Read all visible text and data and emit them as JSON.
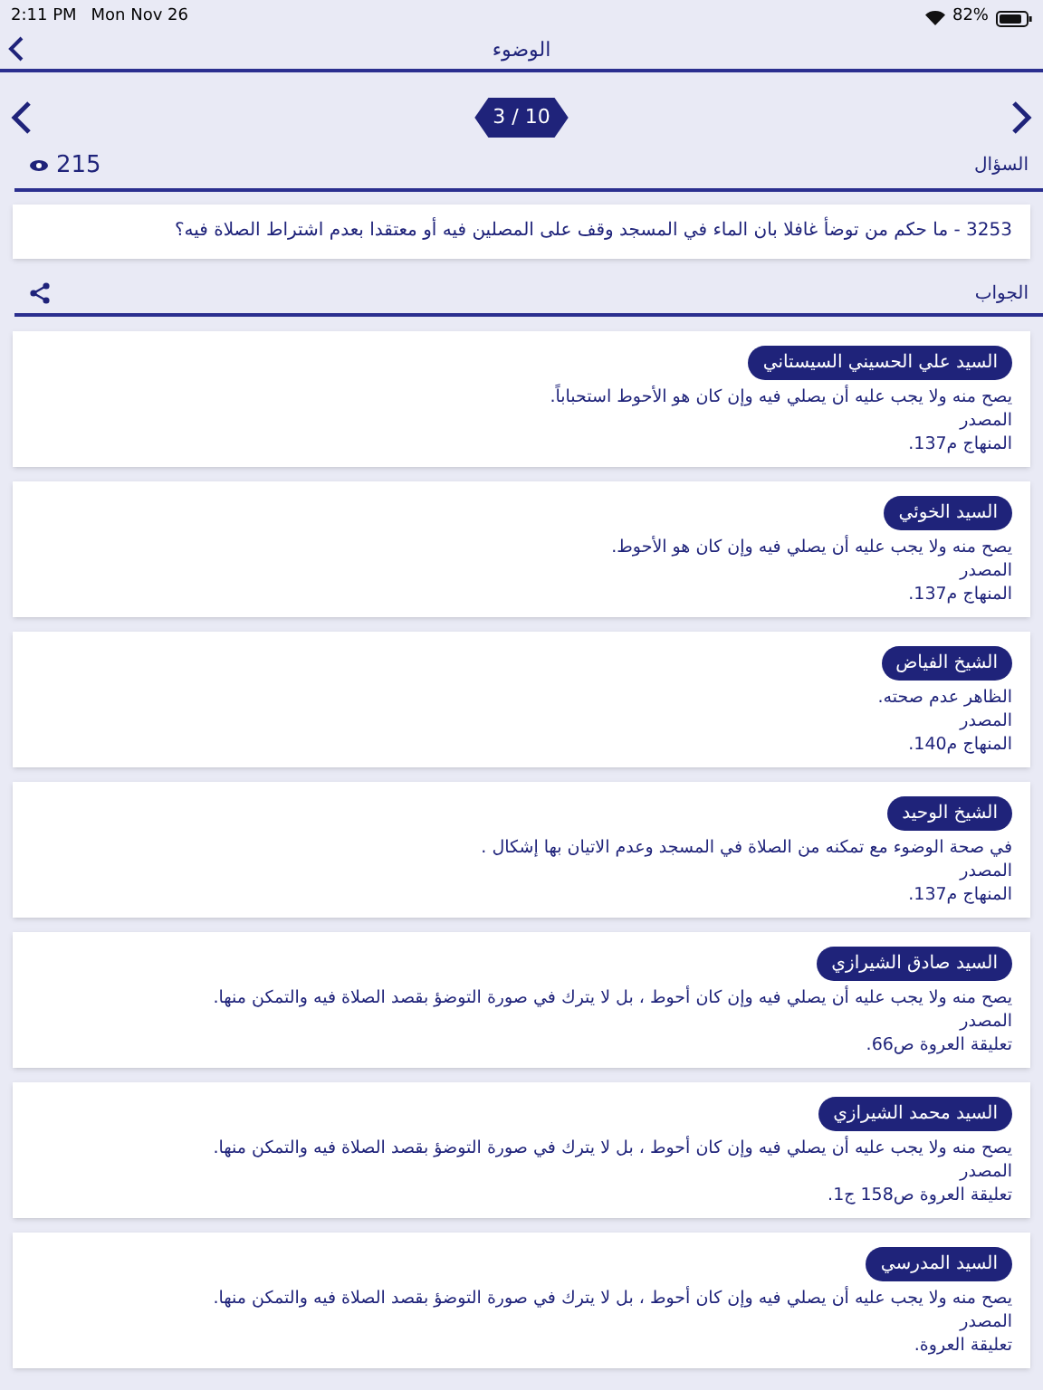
{
  "status_bar": {
    "time": "2:11 PM",
    "date": "Mon Nov 26",
    "battery": "82%"
  },
  "nav": {
    "title": "الوضوء"
  },
  "pager": {
    "label": "3 / 10"
  },
  "question": {
    "heading": "السؤال",
    "views": "215",
    "text": "3253 - ما حكم من توضأ غافلا بان الماء في المسجد وقف على المصلين فيه أو معتقدا بعدم اشتراط الصلاة فيه؟"
  },
  "answer": {
    "heading": "الجواب"
  },
  "answers": [
    {
      "scholar": "السيد علي الحسيني السيستاني",
      "text": "يصح منه ولا يجب عليه أن يصلي فيه وإن كان هو الأحوط استحباباً.",
      "source_label": "المصدر",
      "source": "المنهاج م137."
    },
    {
      "scholar": "السيد الخوئي",
      "text": "يصح منه ولا يجب عليه أن يصلي فيه وإن كان هو الأحوط.",
      "source_label": "المصدر",
      "source": "المنهاج م137."
    },
    {
      "scholar": "الشيخ الفياض",
      "text": "الظاهر عدم صحته.",
      "source_label": "المصدر",
      "source": "المنهاج م140."
    },
    {
      "scholar": "الشيخ الوحيد",
      "text": "في صحة الوضوء مع تمكنه من الصلاة في المسجد وعدم الاتيان بها إشكال .",
      "source_label": "المصدر",
      "source": "المنهاج م137."
    },
    {
      "scholar": "السيد صادق الشيرازي",
      "text": "يصح منه ولا يجب عليه أن يصلي فيه وإن كان أحوط ، بل لا يترك في صورة التوضؤ بقصد الصلاة فيه والتمكن منها.",
      "source_label": "المصدر",
      "source": "تعليقة العروة ص66."
    },
    {
      "scholar": "السيد محمد الشيرازي",
      "text": "يصح منه ولا يجب عليه أن يصلي فيه وإن كان أحوط ، بل لا يترك في صورة التوضؤ بقصد الصلاة فيه والتمكن منها.",
      "source_label": "المصدر",
      "source": "تعليقة العروة ص158 ج1."
    },
    {
      "scholar": "السيد المدرسي",
      "text": "يصح منه ولا يجب عليه أن يصلي فيه وإن كان أحوط ، بل لا يترك في صورة التوضؤ بقصد الصلاة فيه والتمكن منها.",
      "source_label": "المصدر",
      "source": "تعليقة العروة."
    }
  ]
}
